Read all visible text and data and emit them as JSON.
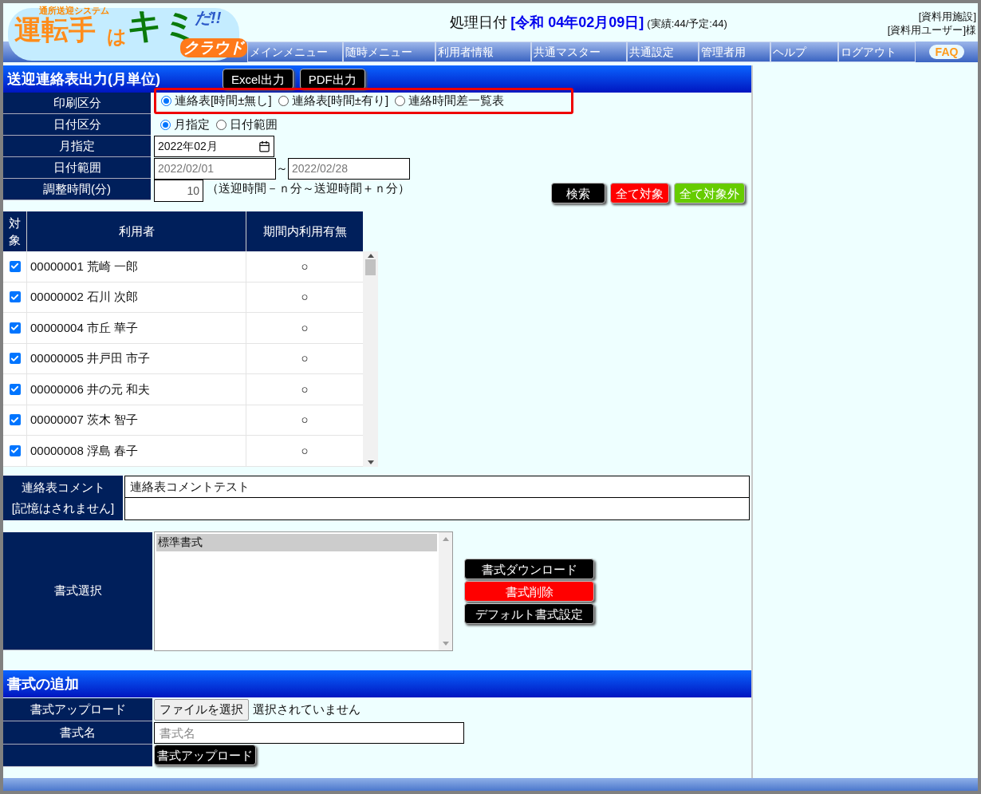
{
  "logo": {
    "tagline": "通所送迎システム",
    "title_a": "運転手",
    "title_b": "は",
    "title_c": "キミ",
    "title_d": "だ!!",
    "title_e": "クラウド"
  },
  "header": {
    "date_label": "処理日付",
    "date_value": "[令和 04年02月09日]",
    "counts": "(実績:44/予定:44)",
    "facility": "[資料用施設]",
    "user": "[資料用ユーザー]様"
  },
  "nav": [
    "メインメニュー",
    "随時メニュー",
    "利用者情報",
    "共通マスター",
    "共通設定",
    "管理者用",
    "ヘルプ",
    "ログアウト"
  ],
  "faq": "FAQ",
  "section": {
    "title": "送迎連絡表出力(月単位)",
    "buttons": [
      "Excel出力",
      "PDF出力"
    ]
  },
  "form": {
    "print_label": "印刷区分",
    "print_options": [
      {
        "label": "連絡表[時間±無し]",
        "selected": true
      },
      {
        "label": "連絡表[時間±有り]",
        "selected": false
      },
      {
        "label": "連絡時間差一覧表",
        "selected": false
      }
    ],
    "date_type_label": "日付区分",
    "date_type_options": [
      {
        "label": "月指定",
        "selected": true
      },
      {
        "label": "日付範囲",
        "selected": false
      }
    ],
    "month_label": "月指定",
    "month_value": "2022年02月",
    "range_label": "日付範囲",
    "range_from": "2022/02/01",
    "range_sep": "～",
    "range_to": "2022/02/28",
    "adjust_label": "調整時間(分)",
    "adjust_value": "10",
    "adjust_note": "（送迎時間－ｎ分～送迎時間＋ｎ分）",
    "actions": [
      {
        "label": "検索",
        "kind": "dark"
      },
      {
        "label": "全て対象",
        "kind": "danger"
      },
      {
        "label": "全て対象外",
        "kind": "success"
      }
    ]
  },
  "table": {
    "columns": [
      "対象",
      "利用者",
      "期間内利用有無"
    ],
    "rows": [
      {
        "checked": true,
        "user": "00000001 荒崎 一郎",
        "usage": "○"
      },
      {
        "checked": true,
        "user": "00000002 石川 次郎",
        "usage": "○"
      },
      {
        "checked": true,
        "user": "00000004 市丘 華子",
        "usage": "○"
      },
      {
        "checked": true,
        "user": "00000005 井戸田 市子",
        "usage": "○"
      },
      {
        "checked": true,
        "user": "00000006 井の元 和夫",
        "usage": "○"
      },
      {
        "checked": true,
        "user": "00000007 茨木 智子",
        "usage": "○"
      },
      {
        "checked": true,
        "user": "00000008 浮島 春子",
        "usage": "○"
      }
    ]
  },
  "comment": {
    "label": "連絡表コメント",
    "note": "[記憶はされません]",
    "line_1": "連絡表コメントテスト"
  },
  "format": {
    "label": "書式選択",
    "options": [
      {
        "label": "標準書式",
        "selected": true
      }
    ],
    "buttons": [
      {
        "label": "書式ダウンロード",
        "kind": "dark"
      },
      {
        "label": "書式削除",
        "kind": "danger"
      },
      {
        "label": "デフォルト書式設定",
        "kind": "dark"
      }
    ]
  },
  "add": {
    "title": "書式の追加",
    "upload_label": "書式アップロード",
    "file_button": "ファイルを選択",
    "file_status": "選択されていません",
    "name_label": "書式名",
    "name_placeholder": "書式名",
    "upload_button": "書式アップロード"
  }
}
